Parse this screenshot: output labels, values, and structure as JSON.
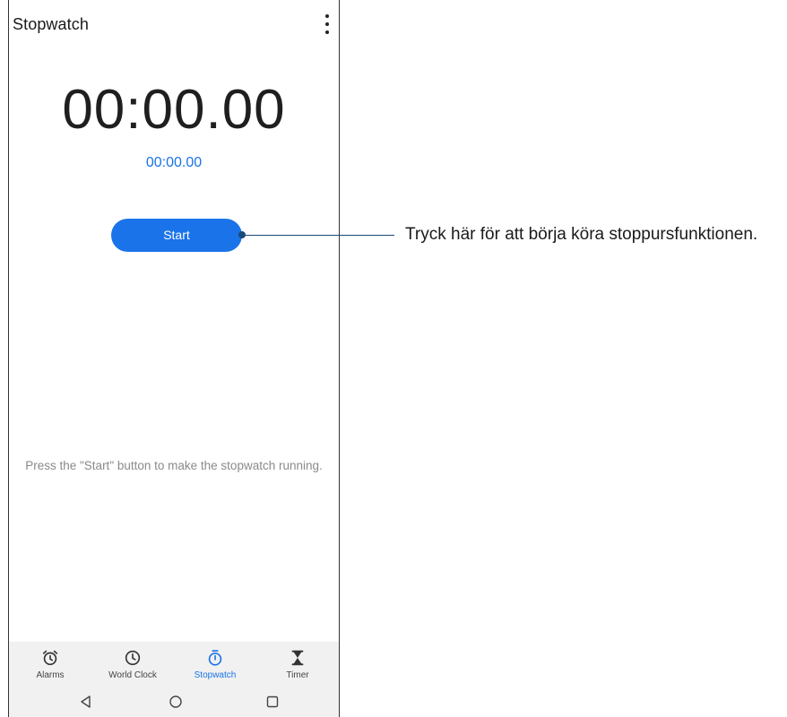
{
  "app": {
    "title": "Stopwatch",
    "more_icon": "more-vertical-icon"
  },
  "stopwatch": {
    "main_time": "00:00.00",
    "lap_time": "00:00.00",
    "start_label": "Start",
    "hint": "Press the \"Start\" button to make the stopwatch running."
  },
  "tabs": [
    {
      "label": "Alarms",
      "icon": "alarm-clock-icon",
      "active": false
    },
    {
      "label": "World Clock",
      "icon": "clock-icon",
      "active": false
    },
    {
      "label": "Stopwatch",
      "icon": "stopwatch-icon",
      "active": true
    },
    {
      "label": "Timer",
      "icon": "hourglass-icon",
      "active": false
    }
  ],
  "system_nav": {
    "back_icon": "back-triangle-icon",
    "home_icon": "home-circle-icon",
    "recents_icon": "recents-square-icon"
  },
  "annotation": {
    "text": "Tryck här för att börja köra stoppursfunktionen."
  },
  "colors": {
    "accent": "#1a73e8",
    "callout": "#1a4a7a",
    "nav_background": "#f1f1f1"
  }
}
